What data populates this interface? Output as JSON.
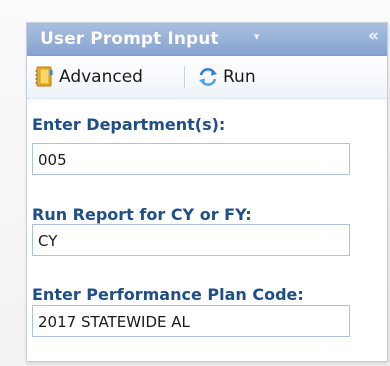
{
  "panel": {
    "title": "User Prompt Input",
    "title_caret": "▾",
    "collapse_glyph": "«"
  },
  "toolbar": {
    "advanced_label": "Advanced",
    "run_label": "Run",
    "advanced_icon": "notebook-icon",
    "run_icon": "refresh-icon"
  },
  "fields": [
    {
      "label": "Enter Department(s):",
      "value": "005"
    },
    {
      "label": "Run Report for CY or FY:",
      "value": "CY"
    },
    {
      "label": "Enter  Performance Plan Code:",
      "value": "2017 STATEWIDE AL"
    }
  ],
  "colors": {
    "title_bar": "#86a4d1",
    "label_text": "#1f4f86",
    "field_border": "#a9c2e2"
  }
}
